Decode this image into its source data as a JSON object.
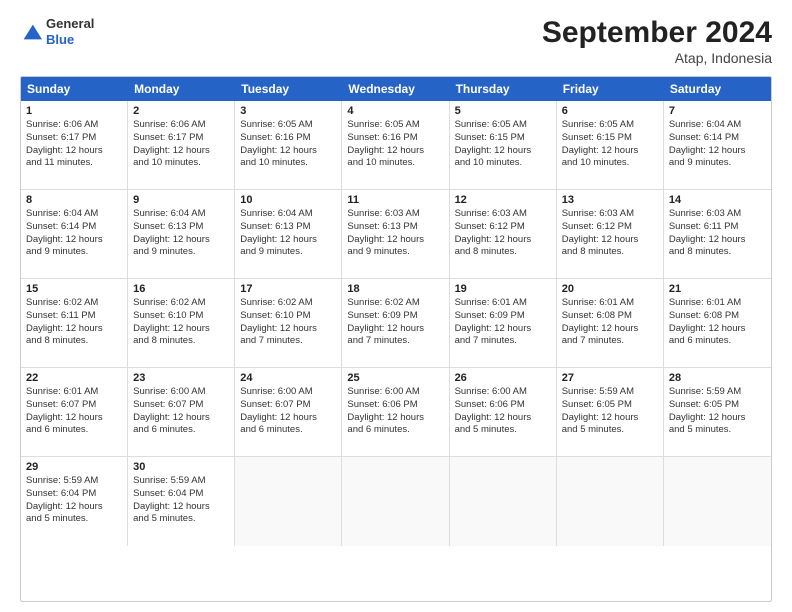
{
  "header": {
    "logo_general": "General",
    "logo_blue": "Blue",
    "title": "September 2024",
    "subtitle": "Atap, Indonesia"
  },
  "weekdays": [
    "Sunday",
    "Monday",
    "Tuesday",
    "Wednesday",
    "Thursday",
    "Friday",
    "Saturday"
  ],
  "weeks": [
    [
      {
        "day": "1",
        "lines": [
          "Sunrise: 6:06 AM",
          "Sunset: 6:17 PM",
          "Daylight: 12 hours",
          "and 11 minutes."
        ]
      },
      {
        "day": "2",
        "lines": [
          "Sunrise: 6:06 AM",
          "Sunset: 6:17 PM",
          "Daylight: 12 hours",
          "and 10 minutes."
        ]
      },
      {
        "day": "3",
        "lines": [
          "Sunrise: 6:05 AM",
          "Sunset: 6:16 PM",
          "Daylight: 12 hours",
          "and 10 minutes."
        ]
      },
      {
        "day": "4",
        "lines": [
          "Sunrise: 6:05 AM",
          "Sunset: 6:16 PM",
          "Daylight: 12 hours",
          "and 10 minutes."
        ]
      },
      {
        "day": "5",
        "lines": [
          "Sunrise: 6:05 AM",
          "Sunset: 6:15 PM",
          "Daylight: 12 hours",
          "and 10 minutes."
        ]
      },
      {
        "day": "6",
        "lines": [
          "Sunrise: 6:05 AM",
          "Sunset: 6:15 PM",
          "Daylight: 12 hours",
          "and 10 minutes."
        ]
      },
      {
        "day": "7",
        "lines": [
          "Sunrise: 6:04 AM",
          "Sunset: 6:14 PM",
          "Daylight: 12 hours",
          "and 9 minutes."
        ]
      }
    ],
    [
      {
        "day": "8",
        "lines": [
          "Sunrise: 6:04 AM",
          "Sunset: 6:14 PM",
          "Daylight: 12 hours",
          "and 9 minutes."
        ]
      },
      {
        "day": "9",
        "lines": [
          "Sunrise: 6:04 AM",
          "Sunset: 6:13 PM",
          "Daylight: 12 hours",
          "and 9 minutes."
        ]
      },
      {
        "day": "10",
        "lines": [
          "Sunrise: 6:04 AM",
          "Sunset: 6:13 PM",
          "Daylight: 12 hours",
          "and 9 minutes."
        ]
      },
      {
        "day": "11",
        "lines": [
          "Sunrise: 6:03 AM",
          "Sunset: 6:13 PM",
          "Daylight: 12 hours",
          "and 9 minutes."
        ]
      },
      {
        "day": "12",
        "lines": [
          "Sunrise: 6:03 AM",
          "Sunset: 6:12 PM",
          "Daylight: 12 hours",
          "and 8 minutes."
        ]
      },
      {
        "day": "13",
        "lines": [
          "Sunrise: 6:03 AM",
          "Sunset: 6:12 PM",
          "Daylight: 12 hours",
          "and 8 minutes."
        ]
      },
      {
        "day": "14",
        "lines": [
          "Sunrise: 6:03 AM",
          "Sunset: 6:11 PM",
          "Daylight: 12 hours",
          "and 8 minutes."
        ]
      }
    ],
    [
      {
        "day": "15",
        "lines": [
          "Sunrise: 6:02 AM",
          "Sunset: 6:11 PM",
          "Daylight: 12 hours",
          "and 8 minutes."
        ]
      },
      {
        "day": "16",
        "lines": [
          "Sunrise: 6:02 AM",
          "Sunset: 6:10 PM",
          "Daylight: 12 hours",
          "and 8 minutes."
        ]
      },
      {
        "day": "17",
        "lines": [
          "Sunrise: 6:02 AM",
          "Sunset: 6:10 PM",
          "Daylight: 12 hours",
          "and 7 minutes."
        ]
      },
      {
        "day": "18",
        "lines": [
          "Sunrise: 6:02 AM",
          "Sunset: 6:09 PM",
          "Daylight: 12 hours",
          "and 7 minutes."
        ]
      },
      {
        "day": "19",
        "lines": [
          "Sunrise: 6:01 AM",
          "Sunset: 6:09 PM",
          "Daylight: 12 hours",
          "and 7 minutes."
        ]
      },
      {
        "day": "20",
        "lines": [
          "Sunrise: 6:01 AM",
          "Sunset: 6:08 PM",
          "Daylight: 12 hours",
          "and 7 minutes."
        ]
      },
      {
        "day": "21",
        "lines": [
          "Sunrise: 6:01 AM",
          "Sunset: 6:08 PM",
          "Daylight: 12 hours",
          "and 6 minutes."
        ]
      }
    ],
    [
      {
        "day": "22",
        "lines": [
          "Sunrise: 6:01 AM",
          "Sunset: 6:07 PM",
          "Daylight: 12 hours",
          "and 6 minutes."
        ]
      },
      {
        "day": "23",
        "lines": [
          "Sunrise: 6:00 AM",
          "Sunset: 6:07 PM",
          "Daylight: 12 hours",
          "and 6 minutes."
        ]
      },
      {
        "day": "24",
        "lines": [
          "Sunrise: 6:00 AM",
          "Sunset: 6:07 PM",
          "Daylight: 12 hours",
          "and 6 minutes."
        ]
      },
      {
        "day": "25",
        "lines": [
          "Sunrise: 6:00 AM",
          "Sunset: 6:06 PM",
          "Daylight: 12 hours",
          "and 6 minutes."
        ]
      },
      {
        "day": "26",
        "lines": [
          "Sunrise: 6:00 AM",
          "Sunset: 6:06 PM",
          "Daylight: 12 hours",
          "and 5 minutes."
        ]
      },
      {
        "day": "27",
        "lines": [
          "Sunrise: 5:59 AM",
          "Sunset: 6:05 PM",
          "Daylight: 12 hours",
          "and 5 minutes."
        ]
      },
      {
        "day": "28",
        "lines": [
          "Sunrise: 5:59 AM",
          "Sunset: 6:05 PM",
          "Daylight: 12 hours",
          "and 5 minutes."
        ]
      }
    ],
    [
      {
        "day": "29",
        "lines": [
          "Sunrise: 5:59 AM",
          "Sunset: 6:04 PM",
          "Daylight: 12 hours",
          "and 5 minutes."
        ]
      },
      {
        "day": "30",
        "lines": [
          "Sunrise: 5:59 AM",
          "Sunset: 6:04 PM",
          "Daylight: 12 hours",
          "and 5 minutes."
        ]
      },
      {
        "day": "",
        "lines": []
      },
      {
        "day": "",
        "lines": []
      },
      {
        "day": "",
        "lines": []
      },
      {
        "day": "",
        "lines": []
      },
      {
        "day": "",
        "lines": []
      }
    ]
  ]
}
